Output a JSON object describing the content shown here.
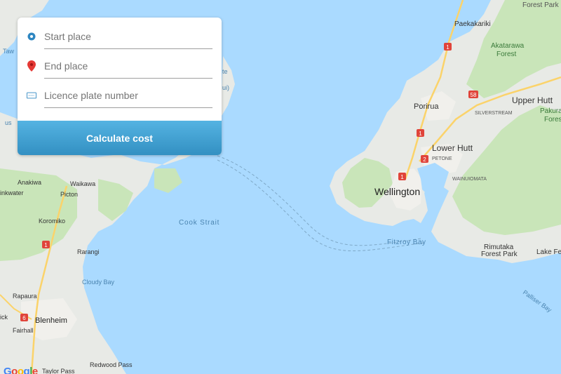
{
  "form": {
    "start_placeholder": "Start place",
    "end_placeholder": "End place",
    "plate_placeholder": "Licence plate number",
    "calculate_label": "Calculate cost"
  },
  "map": {
    "labels": {
      "forest_park": "Forest Park",
      "paekakariki": "Paekakariki",
      "akatarawa_forest_1": "Akatarawa",
      "akatarawa_forest_2": "Forest",
      "porirua": "Porirua",
      "upper_hutt": "Upper Hutt",
      "silverstream": "SILVERSTREAM",
      "lower_hutt": "Lower Hutt",
      "petone": "PETONE",
      "wainuiomata": "WAINUIOMATA",
      "wellington": "Wellington",
      "fitzroy_bay": "Fitzroy Bay",
      "pakura_1": "Pakura",
      "pakura_2": "Fores",
      "rimutaka_1": "Rimutaka",
      "rimutaka_2": "Forest Park",
      "lake_fe": "Lake Fe",
      "palliser_bay": "Palliser Bay",
      "cook_strait": "Cook Strait",
      "anakiwa": "Anakiwa",
      "waikawa": "Waikawa",
      "linkwater": "inkwater",
      "picton": "Picton",
      "koromiko": "Koromiko",
      "rarangi": "Rarangi",
      "cloudy_bay": "Cloudy Bay",
      "rapaura": "Rapaura",
      "blenheim": "Blenheim",
      "fairhall": "Fairhall",
      "ick": "ick",
      "redwood_pass": "Redwood Pass",
      "taylor_pass": "Taylor Pass",
      "taw": "Taw",
      "us": "us",
      "te": "te",
      "ui": "ui)"
    },
    "shields": {
      "r1a": "1",
      "r58": "58",
      "r1b": "1",
      "r2": "2",
      "r1c": "1",
      "r1d": "1",
      "r6": "6"
    },
    "attribution": [
      "G",
      "o",
      "o",
      "g",
      "l",
      "e"
    ],
    "colors": {
      "water": "#aadaff",
      "land": "#e8eae6",
      "forest": "#c9e5b9",
      "urban": "#f1f0ec",
      "highway": "#fbd36a",
      "highway_shield": "#e0443a"
    }
  }
}
